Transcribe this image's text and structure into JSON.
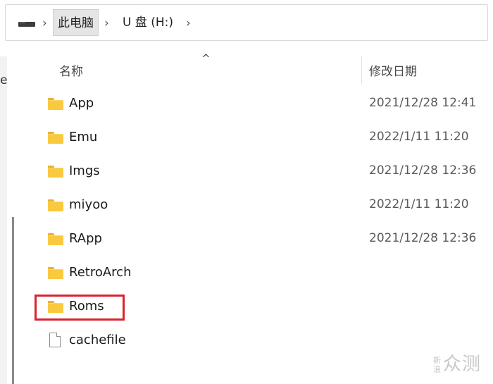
{
  "address_bar": {
    "crumbs": [
      {
        "label": "此电脑"
      },
      {
        "label": "U 盘 (H:)"
      }
    ]
  },
  "left_pane": {
    "partial_text": "e"
  },
  "columns": {
    "name": "名称",
    "date": "修改日期",
    "sort_indicator": "^"
  },
  "files": [
    {
      "name": "App",
      "date": "2021/12/28 12:41",
      "icon": "folder-icon"
    },
    {
      "name": "Emu",
      "date": "2022/1/11 11:20",
      "icon": "folder-icon"
    },
    {
      "name": "Imgs",
      "date": "2021/12/28 12:36",
      "icon": "folder-icon"
    },
    {
      "name": "miyoo",
      "date": "2022/1/11 11:20",
      "icon": "folder-icon"
    },
    {
      "name": "RApp",
      "date": "2021/12/28 12:36",
      "icon": "folder-icon"
    },
    {
      "name": "RetroArch",
      "date": "",
      "icon": "folder-icon"
    },
    {
      "name": "Roms",
      "date": "",
      "icon": "folder-icon",
      "highlighted": true
    },
    {
      "name": "cachefile",
      "date": "",
      "icon": "file-icon"
    }
  ],
  "watermark": {
    "small": "新浪",
    "main": "众测"
  },
  "colors": {
    "highlight": "#d9232e",
    "folder": "#f9c93f"
  }
}
